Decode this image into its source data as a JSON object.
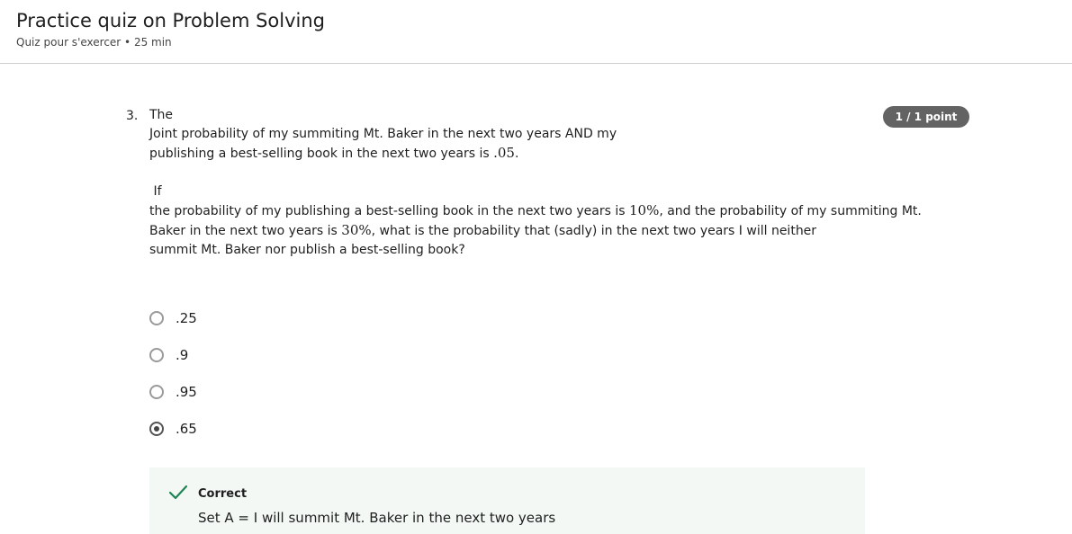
{
  "header": {
    "title": "Practice quiz on Problem Solving",
    "meta": "Quiz pour s'exercer • 25 min"
  },
  "question": {
    "number": "3.",
    "line1": "The",
    "line2": "Joint probability of my summiting Mt. Baker in the next two years AND my",
    "line3_text": "publishing a best-selling book in the next two years is ",
    "line3_math": ".05",
    "line3_end": ".",
    "line4": " If",
    "line5_text": "the probability of my publishing a best-selling book in the next two years is ",
    "line5_math": "10%",
    "line5_end": ", and the probability of my summiting Mt.",
    "line6_text": "Baker in the next two years is ",
    "line6_math": "30%",
    "line6_end": ", what is the probability that (sadly) in the next two years I will neither",
    "line7": "summit Mt. Baker nor publish a best-selling book?",
    "score": "1 / 1 point"
  },
  "options": [
    {
      "label": ".25",
      "selected": false
    },
    {
      "label": ".9",
      "selected": false
    },
    {
      "label": ".95",
      "selected": false
    },
    {
      "label": ".65",
      "selected": true
    }
  ],
  "feedback": {
    "title": "Correct",
    "text": "Set A = I will summit Mt. Baker in the next two years",
    "color": "#1f8354"
  }
}
